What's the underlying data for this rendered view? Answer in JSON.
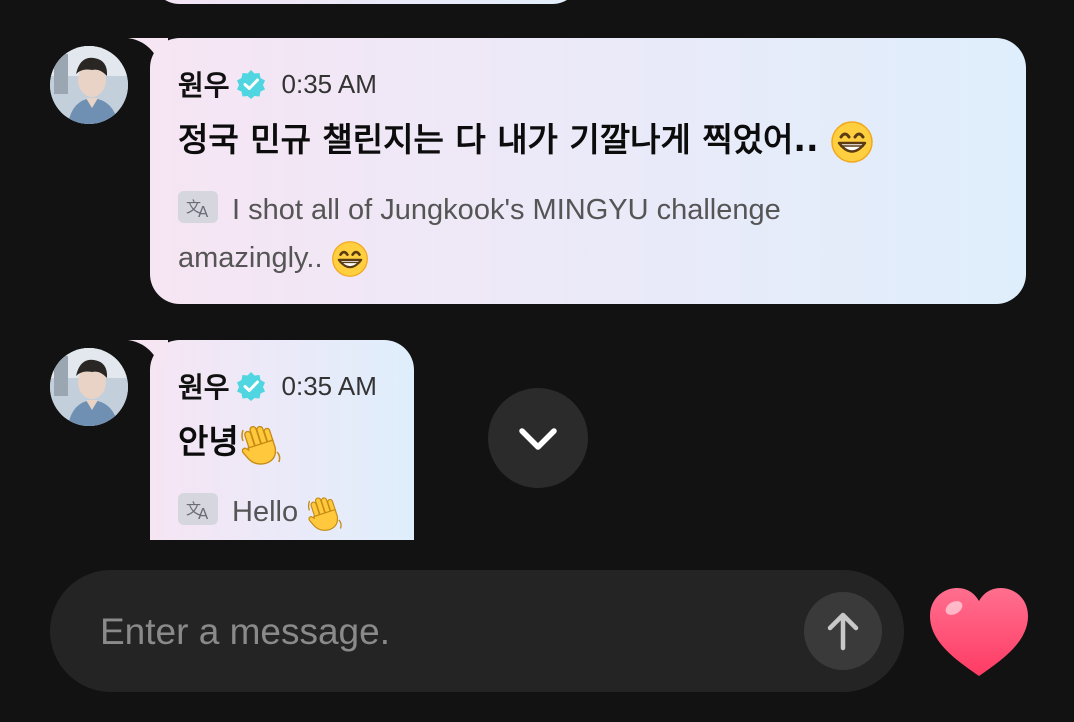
{
  "messages": [
    {
      "sender": "원우",
      "verified": true,
      "time": "0:35 AM",
      "text": "정국 민규 챌린지는 다 내가 기깔나게 찍었어..",
      "text_emoji": "grinning-face",
      "translation_line1": "I shot all of Jungkook's MINGYU challenge",
      "translation_line2": "amazingly..",
      "translation_emoji": "grinning-face"
    },
    {
      "sender": "원우",
      "verified": true,
      "time": "0:35 AM",
      "text": "안녕",
      "text_emoji": "waving-hand",
      "translation": "Hello",
      "translation_emoji": "waving-hand"
    }
  ],
  "composer": {
    "placeholder": "Enter a message."
  },
  "icons": {
    "verified": "verified-badge-icon",
    "translate": "translate-icon",
    "scroll_down": "chevron-down-icon",
    "send": "arrow-up-icon",
    "like": "heart-icon"
  },
  "colors": {
    "background": "#121212",
    "verified": "#4fd6e0",
    "heart": "#ff4a73"
  }
}
